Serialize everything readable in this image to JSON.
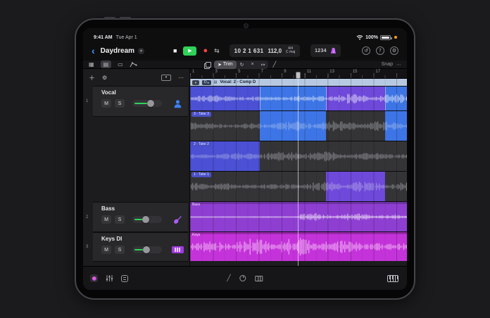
{
  "status": {
    "time": "9:41 AM",
    "date": "Tue Apr 1",
    "battery": "100%"
  },
  "titlebar": {
    "project": "Daydream",
    "transport": {
      "stop": "stop",
      "play": "play",
      "record": "record",
      "cycle": "cycle"
    },
    "lcd": {
      "position": "10 2 1 631",
      "tempo": "112,0",
      "time_signature": "4/4",
      "key": "C maj"
    },
    "count_in": "1234",
    "right_icons": [
      "undo",
      "help",
      "settings"
    ]
  },
  "toolbar": {
    "trim_label": "Trim",
    "snap_label": "Snap"
  },
  "track_headers": {
    "tracks": [
      {
        "number": "1",
        "name": "Vocal",
        "mute": "M",
        "solo": "S",
        "icon": "vocalist"
      },
      {
        "number": "2",
        "name": "Bass",
        "mute": "M",
        "solo": "S",
        "icon": "bass-guitar"
      },
      {
        "number": "3",
        "name": "Keys DI",
        "mute": "M",
        "solo": "S",
        "icon": "keyboard"
      }
    ]
  },
  "timeline": {
    "ruler": [
      "1",
      "3",
      "5",
      "7",
      "9",
      "11",
      "13",
      "15",
      "17"
    ],
    "comp": {
      "letter": "D",
      "title": "Vocal: 2 - Comp D"
    },
    "takes": [
      {
        "label": "3 - Take 3"
      },
      {
        "label": "2 - Take 2"
      },
      {
        "label": "1 - Take 1"
      }
    ],
    "regions": {
      "bass": "Bass",
      "keys": "Keys"
    },
    "playhead_bar": "10"
  },
  "colors": {
    "take1_purple": "#6e49da",
    "take2_indigo": "#4b50d4",
    "take3_blue": "#3d75e6",
    "comp_header": "#b7c9e2",
    "bass_region": "#8e3fd2",
    "keys_region": "#c433da",
    "play_green": "#2fd158",
    "record_red": "#ff453a",
    "metronome_purple": "#bf5af2",
    "accent_blue": "#4699ff",
    "slider_green": "#30d158"
  }
}
